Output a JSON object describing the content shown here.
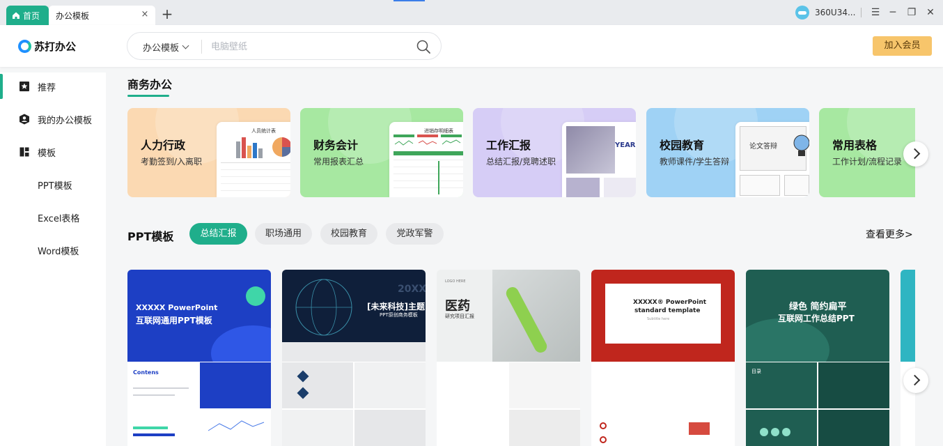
{
  "titlebar": {
    "home_tab": "首页",
    "active_tab": "办公模板",
    "close": "×",
    "add": "+",
    "user": "360U34...",
    "menu": "☰",
    "minimize": "─",
    "restore": "❐",
    "close_window": "✕"
  },
  "header": {
    "logo": "苏打办公",
    "search_category": "办公模板",
    "search_placeholder": "电脑壁纸",
    "vip_button": "加入会员"
  },
  "sidebar": {
    "items": [
      {
        "label": "推荐",
        "icon": "star-icon"
      },
      {
        "label": "我的办公模板",
        "icon": "user-icon"
      },
      {
        "label": "模板",
        "icon": "grid-icon"
      },
      {
        "label": "PPT模板"
      },
      {
        "label": "Excel表格"
      },
      {
        "label": "Word模板"
      }
    ]
  },
  "section": {
    "title": "商务办公",
    "cards": [
      {
        "title": "人力行政",
        "sub": "考勤签到/入离职",
        "bg": "#fbd9b2",
        "thumb": "人员统计表"
      },
      {
        "title": "财务会计",
        "sub": "常用报表汇总",
        "bg": "#a7e8a1",
        "thumb": "进销存明细表"
      },
      {
        "title": "工作汇报",
        "sub": "总结汇报/竞聘述职",
        "bg": "#d6cdf6",
        "thumb": "YEAR-"
      },
      {
        "title": "校园教育",
        "sub": "教师课件/学生答辩",
        "bg": "#9fd2f5",
        "thumb": "论文答辩"
      },
      {
        "title": "常用表格",
        "sub": "工作计划/流程记录",
        "bg": "#a7e8a1"
      }
    ]
  },
  "ppt": {
    "title": "PPT模板",
    "chips": [
      "总结汇报",
      "职场通用",
      "校园教育",
      "党政军警"
    ],
    "more": "查看更多>",
    "templates": [
      {
        "l1": "XXXXX PowerPoint",
        "l2": "互联网通用PPT模板",
        "s1": "Contens"
      },
      {
        "l1": "[未来科技]主题",
        "l2": "PPT原创商务模板",
        "s1": "20XX"
      },
      {
        "l1": "医药",
        "l2": "研究项目汇报",
        "s1": "LOGO HERE"
      },
      {
        "l1": "XXXXX® PowerPoint",
        "l2": "standard template",
        "s1": "Subtitle here"
      },
      {
        "l1": "绿色 简约扁平",
        "l2": "互联网工作总结PPT",
        "s1": "目录"
      }
    ]
  }
}
